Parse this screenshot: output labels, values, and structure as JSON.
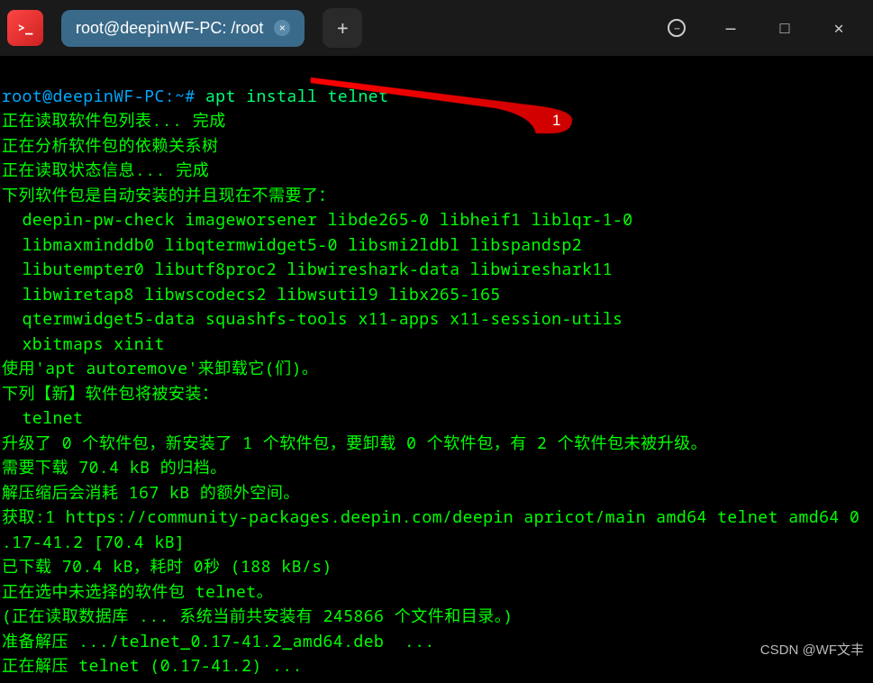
{
  "titlebar": {
    "app_icon_text": ">_",
    "tab_title": "root@deepinWF-PC: /root",
    "tab_close": "×",
    "new_tab": "+"
  },
  "window_controls": {
    "menu": "⋯",
    "minimize": "—",
    "maximize": "□",
    "close": "✕"
  },
  "terminal": {
    "prompt": "root@deepinWF-PC:~#",
    "command": " apt install telnet",
    "lines": [
      "正在读取软件包列表... 完成",
      "正在分析软件包的依赖关系树",
      "正在读取状态信息... 完成",
      "下列软件包是自动安装的并且现在不需要了：",
      "  deepin-pw-check imageworsener libde265-0 libheif1 liblqr-1-0",
      "  libmaxminddb0 libqtermwidget5-0 libsmi2ldbl libspandsp2",
      "  libutempter0 libutf8proc2 libwireshark-data libwireshark11",
      "  libwiretap8 libwscodecs2 libwsutil9 libx265-165",
      "  qtermwidget5-data squashfs-tools x11-apps x11-session-utils",
      "  xbitmaps xinit",
      "使用'apt autoremove'来卸载它(们)。",
      "下列【新】软件包将被安装：",
      "  telnet",
      "升级了 0 个软件包，新安装了 1 个软件包，要卸载 0 个软件包，有 2 个软件包未被升级。",
      "需要下载 70.4 kB 的归档。",
      "解压缩后会消耗 167 kB 的额外空间。",
      "获取:1 https://community-packages.deepin.com/deepin apricot/main amd64 telnet amd64 0",
      ".17-41.2 [70.4 kB]",
      "已下载 70.4 kB，耗时 0秒 (188 kB/s)",
      "正在选中未选择的软件包 telnet。",
      "(正在读取数据库 ... 系统当前共安装有 245866 个文件和目录。)",
      "准备解压 .../telnet_0.17-41.2_amd64.deb  ...",
      "正在解压 telnet (0.17-41.2) ..."
    ]
  },
  "annotation": {
    "label": "1",
    "color": "#ff0000"
  },
  "watermark": "CSDN @WF文丰"
}
